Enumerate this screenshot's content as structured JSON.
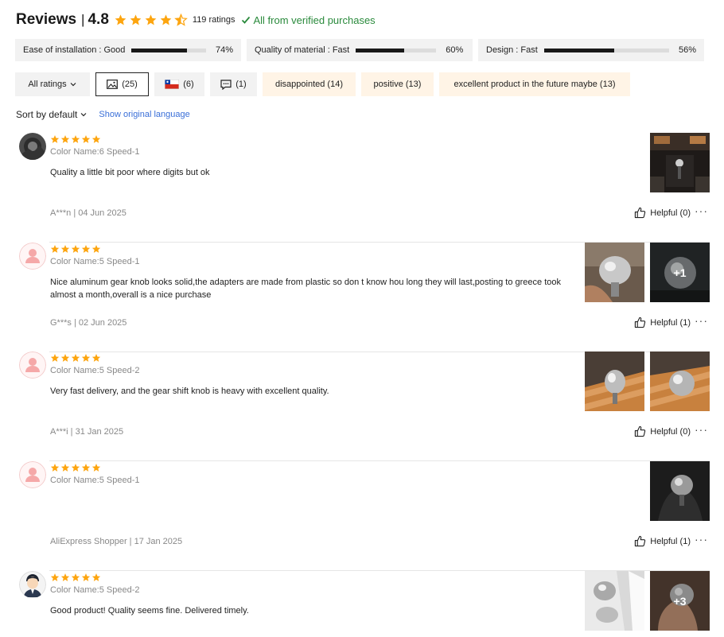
{
  "header": {
    "title": "Reviews",
    "separator": "|",
    "rating": "4.8",
    "rating_count": "119 ratings",
    "verified_text": "All from verified purchases",
    "stars_filled": 4.5
  },
  "metrics": [
    {
      "label": "Ease of installation : Good",
      "percent_label": "74%",
      "value": 0.74
    },
    {
      "label": "Quality of material : Fast",
      "percent_label": "60%",
      "value": 0.6
    },
    {
      "label": "Design : Fast",
      "percent_label": "56%",
      "value": 0.56
    }
  ],
  "filters": {
    "all_ratings": "All ratings",
    "photos": "(25)",
    "country": "(6)",
    "comments": "(1)",
    "tags": [
      "disappointed (14)",
      "positive (13)",
      "excellent product in the future maybe (13)"
    ]
  },
  "sort": {
    "label": "Sort by default",
    "show_original": "Show original language"
  },
  "reviews": [
    {
      "avatar": "photo",
      "stars": 5,
      "color": "Color Name:6 Speed-1",
      "text": "Quality a little bit poor where digits but ok",
      "meta": "A***n | 04 Jun 2025",
      "helpful": "Helpful (0)",
      "photos": [
        "interior"
      ],
      "extra": ""
    },
    {
      "avatar": "default",
      "stars": 5,
      "color": "Color Name:5 Speed-1",
      "text": "Nice aluminum gear knob looks solid,the adapters are made from plastic so don t know hou long they will last,posting to greece took almost a month,overall is a nice purchase",
      "meta": "G***s | 02 Jun 2025",
      "helpful": "Helpful (1)",
      "photos": [
        "knob-hand",
        "knob-dark"
      ],
      "extra": "+1"
    },
    {
      "avatar": "default",
      "stars": 5,
      "color": "Color Name:5 Speed-2",
      "text": "Very fast delivery, and the gear shift knob is heavy with excellent quality.",
      "meta": "A***i | 31 Jan 2025",
      "helpful": "Helpful (0)",
      "photos": [
        "knob-wood",
        "knob-wood"
      ],
      "extra": ""
    },
    {
      "avatar": "default",
      "stars": 5,
      "color": "Color Name:5 Speed-1",
      "text": "",
      "meta": "AliExpress Shopper | 17 Jan 2025",
      "helpful": "Helpful (1)",
      "photos": [
        "knob-car"
      ],
      "extra": ""
    },
    {
      "avatar": "cartoon",
      "stars": 5,
      "color": "Color Name:5 Speed-2",
      "text": "Good product! Quality seems fine. Delivered timely.",
      "meta": "",
      "helpful": "",
      "photos": [
        "knob-package",
        "knob-hand2"
      ],
      "extra": "+3"
    }
  ],
  "colors": {
    "star": "#fda50f",
    "verified": "#2a8a3c",
    "link": "#3a6fd8",
    "tag_bg": "#fff4e6"
  }
}
